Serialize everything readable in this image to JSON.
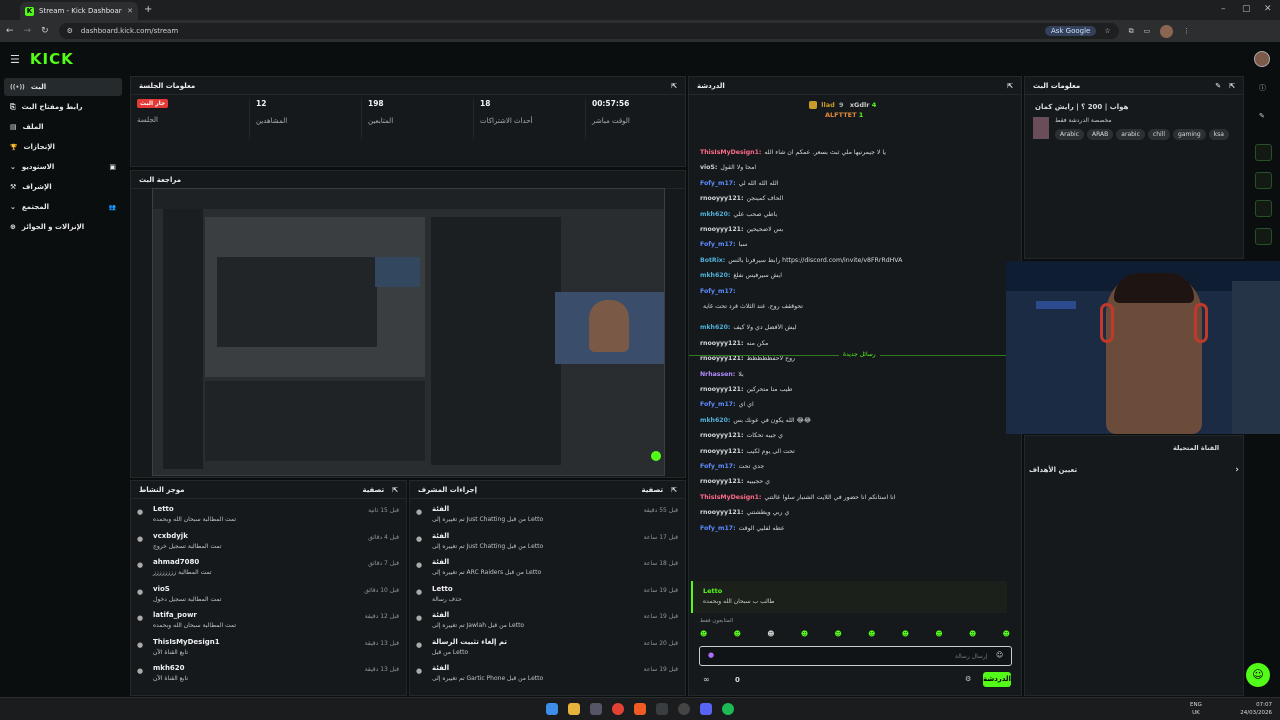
{
  "browser": {
    "tab_title": "Stream - Kick Dashboard",
    "new_tab": "+",
    "url": "dashboard.kick.com/stream",
    "ask_google": "Ask Google",
    "min": "–",
    "max": "▢",
    "close": "✕"
  },
  "app": {
    "logo": "KICK"
  },
  "sidebar": {
    "items": [
      {
        "label": "البث",
        "icon": "((•))"
      },
      {
        "label": "رابط ومفتاح البث",
        "icon": "⎘"
      },
      {
        "label": "الملف",
        "icon": "▤"
      },
      {
        "label": "الإنجازات",
        "icon": "🏆"
      },
      {
        "label": "الاستوديو",
        "icon": "▣"
      },
      {
        "label": "الإشراف",
        "icon": "⚒"
      },
      {
        "label": "المجتمع",
        "icon": "👥"
      },
      {
        "label": "الإنزالات و الجوائز",
        "icon": "⊕"
      }
    ]
  },
  "session": {
    "title": "معلومات الجلسة",
    "live_badge": "جار البث",
    "live_label": "الجلسة",
    "viewers_value": "12",
    "viewers_label": "المشاهدين",
    "followers_value": "198",
    "followers_label": "المتابعين",
    "new_followers_value": "18",
    "new_followers_label": "أحداث الاشتراكات",
    "time_value": "00:57:56",
    "time_label": "الوقت مباشر"
  },
  "preview": {
    "title": "مراجعة البث"
  },
  "activity": {
    "title": "موجز النشاط",
    "filter": "تصفية",
    "rows": [
      {
        "name": "Letto",
        "sub": "تمت المطالبة سبحان الله وبحمده",
        "time": "قبل 15 ثانية"
      },
      {
        "name": "vcxbdyjk",
        "sub": "تمت المطالبة تسجيل خروج",
        "time": "قبل 4 دقائق"
      },
      {
        "name": "ahmad7080",
        "sub": "تمت المطالبة زززززززز",
        "time": "قبل 7 دقائق"
      },
      {
        "name": "vioS",
        "sub": "تمت المطالبة تسجيل دخول",
        "time": "قبل 10 دقائق"
      },
      {
        "name": "latifa_powr",
        "sub": "تمت المطالبة سبحان الله وبحمده",
        "time": "قبل 12 دقيقة"
      },
      {
        "name": "ThisIsMyDesign1",
        "sub": "تابع القناة الآن",
        "time": "قبل 13 دقيقة"
      },
      {
        "name": "mkh620",
        "sub": "تابع القناة الآن",
        "time": "قبل 13 دقيقة"
      }
    ]
  },
  "modactions": {
    "title": "إجراءات المشرف",
    "filter": "تصفية",
    "rows": [
      {
        "name": "الفئة",
        "sub": "تم تغييره إلى Just Chatting من قبل Letto",
        "time": "قبل 55 دقيقة"
      },
      {
        "name": "الفئة",
        "sub": "تم تغييره إلى Just Chatting من قبل Letto",
        "time": "قبل 17 ساعة"
      },
      {
        "name": "الفئة",
        "sub": "تم تغييره إلى ARC Raiders من قبل Letto",
        "time": "قبل 18 ساعة"
      },
      {
        "name": "Letto",
        "sub": "حذف رسالة",
        "time": "قبل 19 ساعة"
      },
      {
        "name": "الفئة",
        "sub": "تم تغييره إلى Jawlah من قبل Letto",
        "time": "قبل 19 ساعة"
      },
      {
        "name": "تم إلغاء تثبيت الرسالة",
        "sub": "من قبل Letto",
        "time": "قبل 20 ساعة"
      },
      {
        "name": "الفئة",
        "sub": "تم تغييره إلى Gartic Phone من قبل Letto",
        "time": "قبل 19 ساعة"
      }
    ]
  },
  "chat": {
    "title": "الدردشة",
    "top": {
      "a": "llad",
      "a_n": "5",
      "b": "xGdlr",
      "b_n": "4",
      "c": "ALFTTET",
      "c_n": "1",
      "d_n": "9"
    },
    "new_messages": "رسائل جديدة",
    "messages": [
      {
        "user": "ThisIsMyDesign1:",
        "text": "يا لا جيمرنيها ملي ثبث بسعر. عمكم ان شاء الله",
        "color": "#ff6b8a"
      },
      {
        "user": "vioS:",
        "text": "امحا ولا القول",
        "color": "#cfd3d6"
      },
      {
        "user": "Fofy_m17:",
        "text": "الله الله الله لي",
        "color": "#5b8cff"
      },
      {
        "user": "rnooyyy121:",
        "text": "الحاف كمينجن",
        "color": "#d6dadc"
      },
      {
        "user": "mkh620:",
        "text": "باطي صحب علي",
        "color": "#4fb0d9"
      },
      {
        "user": "rnooyyy121:",
        "text": "بس لاضحيحين",
        "color": "#d6dadc"
      },
      {
        "user": "Fofy_m17:",
        "text": "سبأ",
        "color": "#5b8cff"
      },
      {
        "user": "BotRix:",
        "text": "رابط سيرفرنا بالنس https://discord.com/invite/v8FRrRdHVA",
        "color": "#4fb0d9"
      },
      {
        "user": "mkh620:",
        "text": "ايش سيرفيس نفلغ",
        "color": "#4fb0d9"
      },
      {
        "user": "Fofy_m17:",
        "text": "",
        "color": "#5b8cff"
      },
      {
        "user": "",
        "text": "تحوققف روح. عند الثلاث قرد تحت غاية",
        "color": "#d6dadc"
      },
      {
        "user": "mkh620:",
        "text": "ليش الأفضل دي ولا كيف",
        "color": "#4fb0d9"
      },
      {
        "user": "rnooyyy121:",
        "text": "مكن منه",
        "color": "#d6dadc"
      },
      {
        "user": "rnooyyy121:",
        "text": "روح لاحفظظظظظ",
        "color": "#d6dadc"
      },
      {
        "user": "Nrhassen:",
        "text": "بلا",
        "color": "#b18cff"
      },
      {
        "user": "rnooyyy121:",
        "text": "طيب منا متحركين",
        "color": "#d6dadc"
      },
      {
        "user": "Fofy_m17:",
        "text": "اي اي",
        "color": "#5b8cff"
      },
      {
        "user": "mkh620:",
        "text": "الله يكون في عونك بس 😂😂",
        "color": "#4fb0d9"
      },
      {
        "user": "rnooyyy121:",
        "text": "ي جيبه تحكات",
        "color": "#d6dadc"
      },
      {
        "user": "rnooyyy121:",
        "text": "تحت الى يوم لكيب",
        "color": "#d6dadc"
      },
      {
        "user": "Fofy_m17:",
        "text": "جدي تحت",
        "color": "#5b8cff"
      },
      {
        "user": "rnooyyy121:",
        "text": "ي حجيبيه",
        "color": "#d6dadc"
      },
      {
        "user": "ThisIsMyDesign1:",
        "text": "انا استانكم انا حضور في اللايت الشنبار سلوا عالتني",
        "color": "#ff6b8a"
      },
      {
        "user": "rnooyyy121:",
        "text": "ي ربي ويطشتني",
        "color": "#d6dadc"
      },
      {
        "user": "Fofy_m17:",
        "text": "عطه لفليي الوقت",
        "color": "#5b8cff"
      }
    ],
    "pinned_user": "Letto",
    "pinned_text": "طالب ب سبحان الله وبحمده",
    "followers_only": "المتابعون فقط",
    "input_placeholder": "إرسال رسالة",
    "count": "0",
    "send": "الدردشة"
  },
  "streaminfo": {
    "title": "معلومات البث",
    "name": "هواب | 200 ؟ | رايش كمان",
    "sub": "مخصصة الدردشة فقط",
    "tags": [
      "Arabic",
      "ARAB",
      "arabic",
      "chill",
      "gaming",
      "ksa"
    ],
    "channel_title": "القناة المتحيلة",
    "goals": "تعيين الأهداف"
  },
  "taskbar": {
    "lang": "ENG",
    "region": "UK",
    "time": "07:07",
    "date": "24/03/2026"
  },
  "colors": {
    "accent": "#53fc18",
    "bg": "#0b0e0f",
    "panel": "#16191b"
  }
}
